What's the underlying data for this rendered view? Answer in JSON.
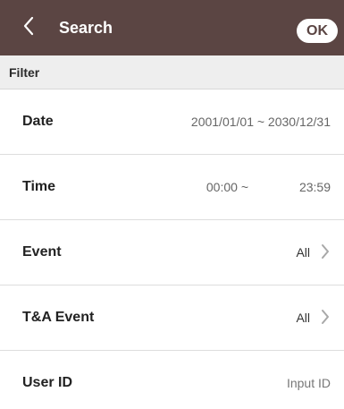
{
  "header": {
    "title": "Search",
    "ok_label": "OK",
    "back_icon": "chevron-left-icon",
    "background_color": "#5b4543"
  },
  "filter": {
    "section_title": "Filter"
  },
  "rows": {
    "date": {
      "label": "Date",
      "value": "2001/01/01 ~ 2030/12/31"
    },
    "time": {
      "label": "Time",
      "start": "00:00 ~",
      "end": "23:59"
    },
    "event": {
      "label": "Event",
      "value": "All",
      "icon": "chevron-right-icon"
    },
    "ta_event": {
      "label": "T&A Event",
      "value": "All",
      "icon": "chevron-right-icon"
    },
    "user_id": {
      "label": "User ID",
      "placeholder": "Input ID",
      "value": ""
    }
  }
}
